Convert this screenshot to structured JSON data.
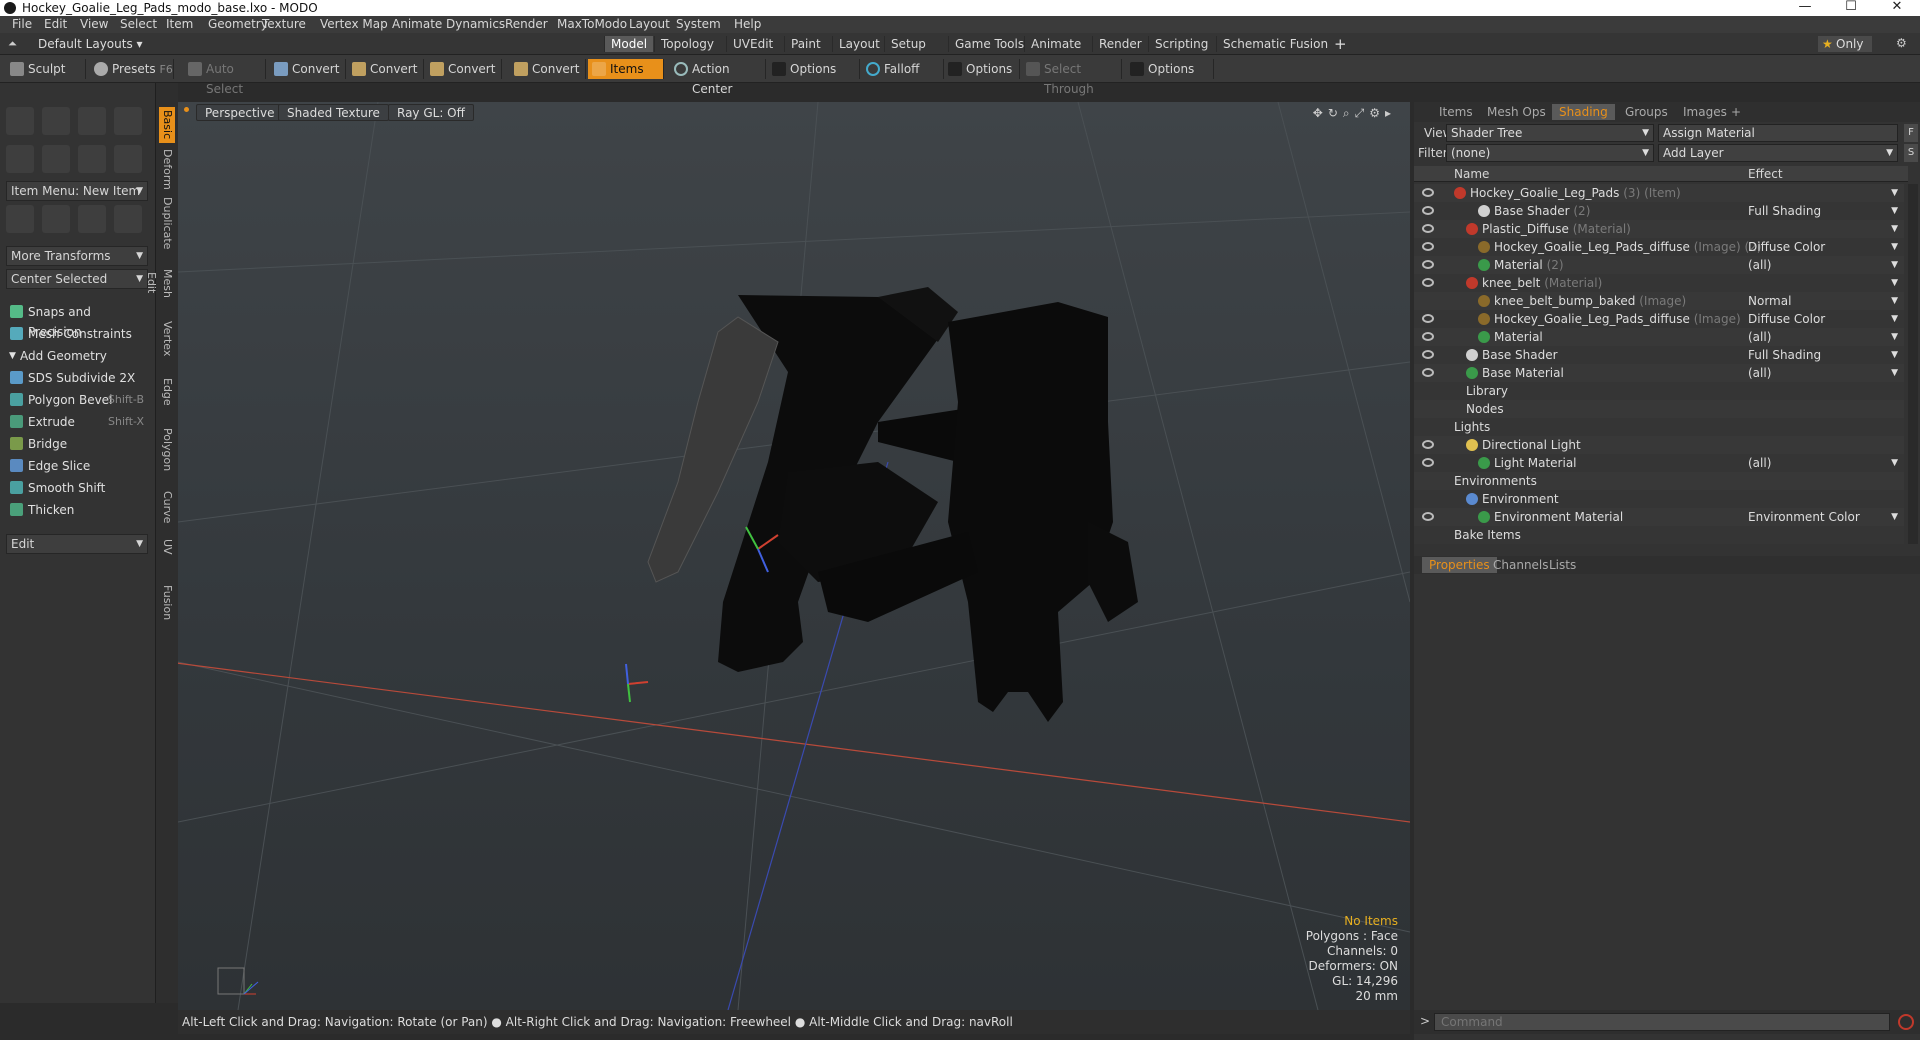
{
  "window": {
    "title": "Hockey_Goalie_Leg_Pads_modo_base.lxo - MODO",
    "minimize": "—",
    "maximize": "☐",
    "close": "✕"
  },
  "menu": [
    "File",
    "Edit",
    "View",
    "Select",
    "Item",
    "Geometry",
    "Texture",
    "Vertex Map",
    "Animate",
    "Dynamics",
    "Render",
    "MaxToModo",
    "Layout",
    "System",
    "Help"
  ],
  "layouts": {
    "default": "Default Layouts",
    "tabs": [
      "Model",
      "Topology",
      "UVEdit",
      "Paint",
      "Layout",
      "Setup",
      "Game Tools",
      "Animate",
      "Render",
      "Scripting",
      "Schematic Fusion"
    ],
    "active": "Model",
    "plus": "+",
    "only": "Only"
  },
  "toolbar": {
    "sculpt": "Sculpt",
    "presets": "Presets",
    "presets_key": "F6",
    "auto_select": "Auto Select",
    "convert": "Convert",
    "items": "Items",
    "action_center": "Action Center",
    "options": "Options",
    "falloff": "Falloff",
    "select_through": "Select Through"
  },
  "left": {
    "item_menu": "Item Menu: New Item",
    "more_transforms": "More Transforms",
    "center_selected": "Center Selected",
    "snaps": "Snaps and Precision",
    "mesh_constraints": "Mesh Constraints",
    "add_geometry": "Add Geometry",
    "tools": [
      {
        "label": "SDS Subdivide 2X",
        "key": ""
      },
      {
        "label": "Polygon Bevel",
        "key": "Shift-B"
      },
      {
        "label": "Extrude",
        "key": "Shift-X"
      },
      {
        "label": "Bridge",
        "key": ""
      },
      {
        "label": "Edge Slice",
        "key": ""
      },
      {
        "label": "Smooth Shift",
        "key": ""
      },
      {
        "label": "Thicken",
        "key": ""
      }
    ],
    "edit": "Edit",
    "vtabs": [
      "Basic",
      "Deform",
      "Duplicate",
      "Mesh Edit",
      "Vertex",
      "Edge",
      "Polygon",
      "Curve",
      "UV",
      "Fusion"
    ]
  },
  "viewport": {
    "perspective": "Perspective",
    "shading": "Shaded Texture",
    "raygl": "Ray GL: Off",
    "stats": [
      "No Items",
      "Polygons : Face",
      "Channels: 0",
      "Deformers: ON",
      "GL: 14,296",
      "20 mm"
    ]
  },
  "status": "Alt-Left Click and Drag: Navigation: Rotate (or Pan) ● Alt-Right Click and Drag: Navigation: Freewheel ● Alt-Middle Click and Drag: navRoll",
  "right": {
    "tabs": [
      "Items",
      "Mesh Ops",
      "Shading",
      "Groups",
      "Images"
    ],
    "active": "Shading",
    "view_label": "View",
    "view_value": "Shader Tree",
    "assign": "Assign Material",
    "filter_label": "Filter",
    "filter_value": "(none)",
    "add_layer": "Add Layer",
    "col_name": "Name",
    "col_effect": "Effect",
    "rows": [
      {
        "name": "Hockey_Goalie_Leg_Pads",
        "type": "(3) (Item)",
        "effect": "",
        "eye": true,
        "indent": 0,
        "color": "#c0392b"
      },
      {
        "name": "Base Shader",
        "type": "(2)",
        "effect": "Full Shading",
        "eye": true,
        "indent": 2,
        "color": "#d0d0d0"
      },
      {
        "name": "Plastic_Diffuse",
        "type": "(Material)",
        "effect": "",
        "eye": true,
        "indent": 1,
        "color": "#c0392b"
      },
      {
        "name": "Hockey_Goalie_Leg_Pads_diffuse",
        "type": "(Image) (2)",
        "effect": "Diffuse Color",
        "eye": true,
        "indent": 2,
        "color": "#8a6a2a"
      },
      {
        "name": "Material",
        "type": "(2)",
        "effect": "(all)",
        "eye": true,
        "indent": 2,
        "color": "#3a9a4a"
      },
      {
        "name": "knee_belt",
        "type": "(Material)",
        "effect": "",
        "eye": true,
        "indent": 1,
        "color": "#c0392b"
      },
      {
        "name": "knee_belt_bump_baked",
        "type": "(Image)",
        "effect": "Normal",
        "eye": false,
        "indent": 2,
        "color": "#8a6a2a"
      },
      {
        "name": "Hockey_Goalie_Leg_Pads_diffuse",
        "type": "(Image)",
        "effect": "Diffuse Color",
        "eye": true,
        "indent": 2,
        "color": "#8a6a2a"
      },
      {
        "name": "Material",
        "type": "",
        "effect": "(all)",
        "eye": true,
        "indent": 2,
        "color": "#3a9a4a"
      },
      {
        "name": "Base Shader",
        "type": "",
        "effect": "Full Shading",
        "eye": true,
        "indent": 1,
        "color": "#d0d0d0"
      },
      {
        "name": "Base Material",
        "type": "",
        "effect": "(all)",
        "eye": true,
        "indent": 1,
        "color": "#3a9a4a"
      },
      {
        "name": "Library",
        "type": "",
        "effect": "",
        "eye": false,
        "indent": 1,
        "color": ""
      },
      {
        "name": "Nodes",
        "type": "",
        "effect": "",
        "eye": false,
        "indent": 1,
        "color": ""
      },
      {
        "name": "Lights",
        "type": "",
        "effect": "",
        "eye": false,
        "indent": 0,
        "color": ""
      },
      {
        "name": "Directional Light",
        "type": "",
        "effect": "",
        "eye": true,
        "indent": 1,
        "color": "#e0c050"
      },
      {
        "name": "Light Material",
        "type": "",
        "effect": "(all)",
        "eye": true,
        "indent": 2,
        "color": "#3a9a4a"
      },
      {
        "name": "Environments",
        "type": "",
        "effect": "",
        "eye": false,
        "indent": 0,
        "color": ""
      },
      {
        "name": "Environment",
        "type": "",
        "effect": "",
        "eye": false,
        "indent": 1,
        "color": "#5a8ad0"
      },
      {
        "name": "Environment Material",
        "type": "",
        "effect": "Environment Color",
        "eye": true,
        "indent": 2,
        "color": "#3a9a4a"
      },
      {
        "name": "Bake Items",
        "type": "",
        "effect": "",
        "eye": false,
        "indent": 0,
        "color": ""
      }
    ],
    "prop_tabs": [
      "Properties",
      "Channels",
      "Lists"
    ],
    "prop_active": "Properties",
    "command_placeholder": "Command"
  }
}
